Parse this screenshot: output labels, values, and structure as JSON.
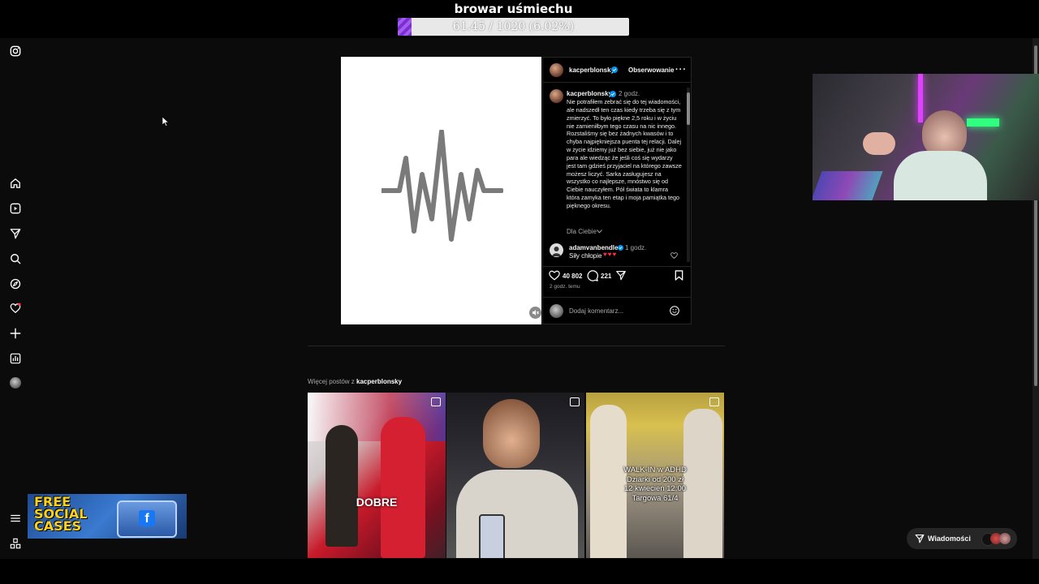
{
  "overlay": {
    "title": "browar uśmiechu",
    "goal_text": "61.45 / 1020 (6.02%)",
    "goal_fraction": 0.0602
  },
  "sidebar": {
    "icons": [
      "instagram-icon",
      "home-icon",
      "reels-icon",
      "messages-icon",
      "search-icon",
      "explore-icon",
      "notifications-icon",
      "create-icon",
      "dashboard-icon",
      "profile-avatar",
      "menu-icon",
      "more-icon"
    ]
  },
  "post": {
    "header_username": "kacperblonsky",
    "follow_label": "Obserwowanie",
    "caption_username": "kacperblonsky",
    "caption_time": "2 godz.",
    "caption_text": "Nie potrafiłem zebrać się do tej wiadomości, ale nadszedł ten czas kiedy trzeba się z tym zmierzyć. To było piękne 2,5 roku i w życiu nie zamieniłbym tego czasu na nic innego. Rozstaliśmy się bez żadnych kwasów i to chyba najpiękniejsza puenta tej relacji. Dalej w życie idziemy już bez siebie, już nie jako para ale wiedząc że jeśli coś się wydarzy jest tam gdzieś przyjaciel na którego zawsze możesz liczyć. Sarka zasługujesz na wszystko co najlepsze, mnóstwo się od Ciebie nauczyłem. Pół świata to klamra która zamyka ten etap i moja pamiątka tego pięknego okresu.",
    "for_you_label": "Dla Ciebie",
    "comment_username": "adamvanbendler",
    "comment_time": "1 godz.",
    "comment_text": "Siły chłopie",
    "like_count": "40 802",
    "comment_count": "221",
    "posted_ago": "2 godz. temu",
    "add_comment_placeholder": "Dodaj komentarz..."
  },
  "more_posts": {
    "prefix": "Więcej postów z",
    "username": "kacperblonsky",
    "thumbnails": [
      {
        "overlay_text": "DOBRE"
      },
      {
        "overlay_text": ""
      },
      {
        "overlay_lines": [
          "WALK-IN w ADHD",
          "Dziarki od 200 zł",
          "12 kwiecień 12:00",
          "Targowa 61/4"
        ]
      }
    ]
  },
  "ad": {
    "line1": "FREE",
    "line2": "SOCIAL",
    "line3": "CASES"
  },
  "messages": {
    "label": "Wiadomości"
  },
  "colors": {
    "accent": "#0095f6",
    "heart_red": "#ff3040",
    "goal_purple": "#7b2fd0"
  }
}
